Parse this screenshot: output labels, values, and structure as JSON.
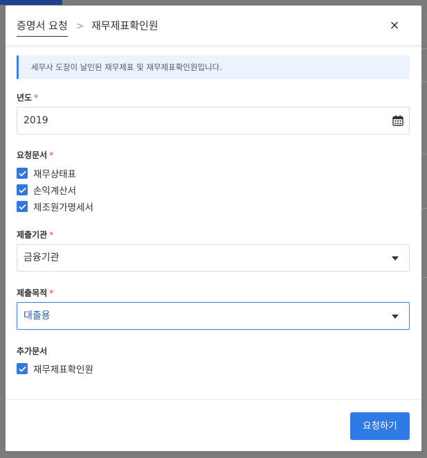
{
  "breadcrumb": {
    "parent": "증명서 요청",
    "separator": ">",
    "current": "재무제표확인원"
  },
  "close_label": "×",
  "notice": "세무사 도장이 날인된 재무제표 및 재무제표확인원입니다.",
  "required_mark": "*",
  "year": {
    "label": "년도",
    "value": "2019"
  },
  "documents": {
    "label": "요청문서",
    "items": [
      "재무상태표",
      "손익계산서",
      "제조원가명세서"
    ]
  },
  "institution": {
    "label": "제출기관",
    "value": "금융기관"
  },
  "purpose": {
    "label": "제출목적",
    "value": "대출용"
  },
  "additional": {
    "label": "추가문서",
    "items": [
      "재무제표확인원"
    ]
  },
  "submit_label": "요청하기",
  "colors": {
    "accent": "#2f7be6",
    "required": "#e23b3b",
    "notice_bg": "#edf3fd"
  }
}
